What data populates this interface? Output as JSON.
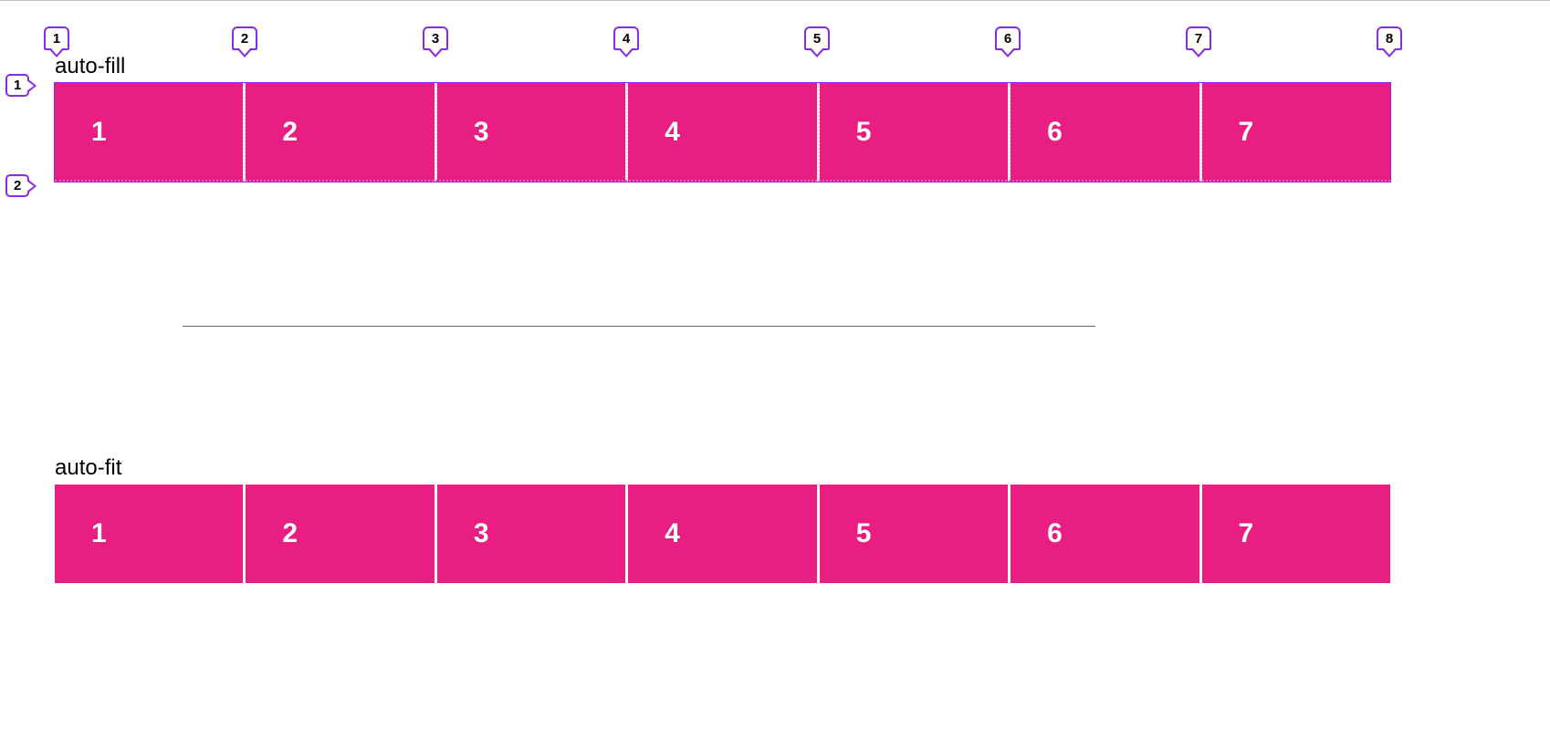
{
  "labels": {
    "top": "auto-fill",
    "bottom": "auto-fit"
  },
  "cells": {
    "top": [
      "1",
      "2",
      "3",
      "4",
      "5",
      "6",
      "7"
    ],
    "bottom": [
      "1",
      "2",
      "3",
      "4",
      "5",
      "6",
      "7"
    ]
  },
  "inspector": {
    "columns": [
      "1",
      "2",
      "3",
      "4",
      "5",
      "6",
      "7",
      "8"
    ],
    "rows": [
      "1",
      "2"
    ]
  },
  "colors": {
    "pink": "#e91e82",
    "purple": "#8a2be2"
  },
  "chart_data": {
    "type": "table",
    "title": "CSS Grid auto-fill vs auto-fit with 7 items",
    "series": [
      {
        "name": "auto-fill",
        "values": [
          1,
          2,
          3,
          4,
          5,
          6,
          7
        ]
      },
      {
        "name": "auto-fit",
        "values": [
          1,
          2,
          3,
          4,
          5,
          6,
          7
        ]
      }
    ],
    "grid_inspector": {
      "column_line_numbers": [
        1,
        2,
        3,
        4,
        5,
        6,
        7,
        8
      ],
      "row_line_numbers": [
        1,
        2
      ]
    }
  }
}
